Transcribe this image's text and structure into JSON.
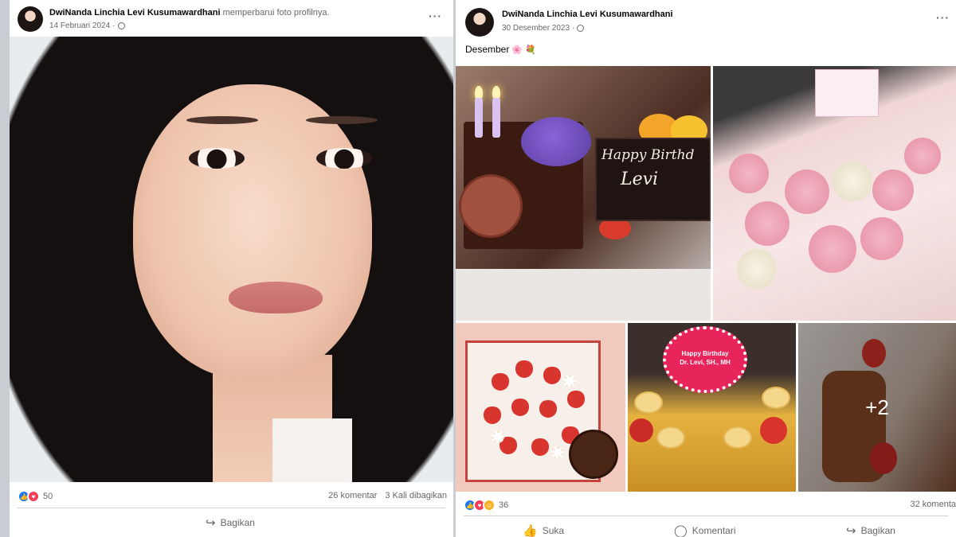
{
  "left_post": {
    "author": "DwiNanda Linchia Levi Kusumawardhani",
    "action": "memperbarui foto profilnya.",
    "date": "14 Februari 2024",
    "more": "···",
    "reaction_count": "50",
    "comments": "26 komentar",
    "shares": "3 Kali dibagikan",
    "share_label": "Bagikan"
  },
  "right_post": {
    "author": "DwiNanda Linchia Levi Kusumawardhani",
    "date": "30 Desember 2023",
    "more": "···",
    "caption": "Desember",
    "photo_texts": {
      "plaque_line1": "Happy Birthd",
      "plaque_line2": "Levi",
      "topper_line1": "Happy Birthday",
      "topper_line2": "Dr. Levi, SH., MH",
      "more_photos": "+2"
    },
    "reaction_count": "36",
    "comments": "32 komenta",
    "like_label": "Suka",
    "comment_label": "Komentari",
    "share_label": "Bagikan"
  },
  "icons": [
    "globe-icon",
    "more-icon",
    "like-reaction-icon",
    "love-reaction-icon",
    "haha-reaction-icon",
    "share-icon",
    "like-icon",
    "comment-icon"
  ],
  "colors": {
    "like_blue": "#1877f2",
    "love_red": "#f33e58",
    "muted_text": "#65676b",
    "feed_bg": "#c9ccd1"
  }
}
